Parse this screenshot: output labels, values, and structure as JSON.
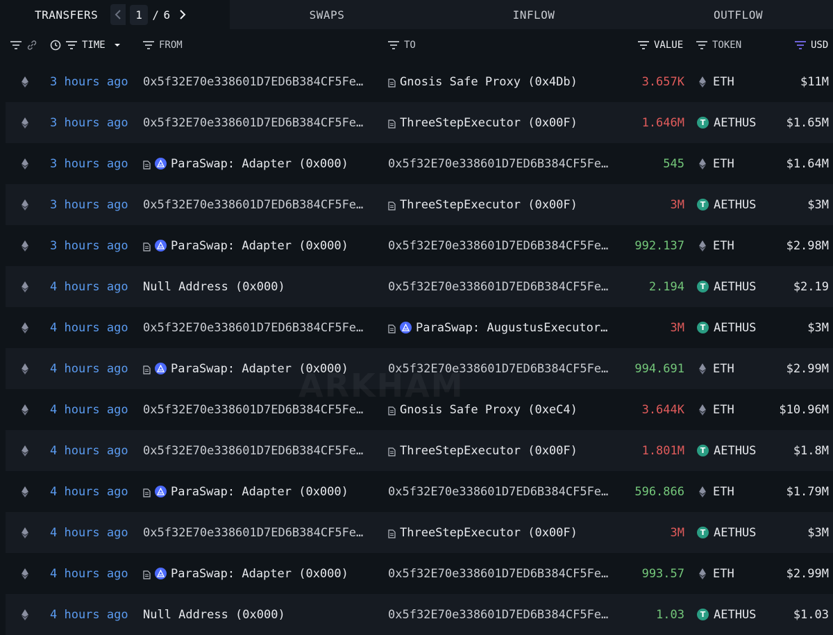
{
  "tabs": {
    "transfers": "TRANSFERS",
    "swaps": "SWAPS",
    "inflow": "INFLOW",
    "outflow": "OUTFLOW",
    "page_current": "1",
    "page_separator": "/",
    "page_total": "6"
  },
  "columns": {
    "time": "TIME",
    "from": "FROM",
    "to": "TO",
    "value": "VALUE",
    "token": "TOKEN",
    "usd": "USD"
  },
  "watermark": "ARKHAM",
  "colors": {
    "background": "#0f1419",
    "row_alt": "#161b22",
    "time_link": "#5b9bf0",
    "outflow_value": "#e05b5b",
    "inflow_value": "#74c77a",
    "paraswap_badge": "#4d6bff",
    "aethus_badge": "#2a9d83"
  },
  "rows": [
    {
      "time": "3 hours ago",
      "from": "0x5f32E70e338601D7ED6B384CF5Fe…",
      "from_icon": "",
      "to": "Gnosis Safe Proxy (0x4Db)",
      "to_icon": "doc",
      "value": "3.657K",
      "dir": "neg",
      "token": "ETH",
      "token_icon": "eth",
      "usd": "$11M"
    },
    {
      "time": "3 hours ago",
      "from": "0x5f32E70e338601D7ED6B384CF5Fe…",
      "from_icon": "",
      "to": "ThreeStepExecutor (0x00F)",
      "to_icon": "doc",
      "value": "1.646M",
      "dir": "neg",
      "token": "AETHUS",
      "token_icon": "usdt",
      "usd": "$1.65M"
    },
    {
      "time": "3 hours ago",
      "from": "ParaSwap: Adapter (0x000)",
      "from_icon": "doc-para",
      "to": "0x5f32E70e338601D7ED6B384CF5Fe…",
      "to_icon": "",
      "value": "545",
      "dir": "pos",
      "token": "ETH",
      "token_icon": "eth",
      "usd": "$1.64M"
    },
    {
      "time": "3 hours ago",
      "from": "0x5f32E70e338601D7ED6B384CF5Fe…",
      "from_icon": "",
      "to": "ThreeStepExecutor (0x00F)",
      "to_icon": "doc",
      "value": "3M",
      "dir": "neg",
      "token": "AETHUS",
      "token_icon": "usdt",
      "usd": "$3M"
    },
    {
      "time": "3 hours ago",
      "from": "ParaSwap: Adapter (0x000)",
      "from_icon": "doc-para",
      "to": "0x5f32E70e338601D7ED6B384CF5Fe…",
      "to_icon": "",
      "value": "992.137",
      "dir": "pos",
      "token": "ETH",
      "token_icon": "eth",
      "usd": "$2.98M"
    },
    {
      "time": "4 hours ago",
      "from": "Null Address (0x000)",
      "from_icon": "",
      "to": "0x5f32E70e338601D7ED6B384CF5Fe…",
      "to_icon": "",
      "value": "2.194",
      "dir": "pos",
      "token": "AETHUS",
      "token_icon": "usdt",
      "usd": "$2.19"
    },
    {
      "time": "4 hours ago",
      "from": "0x5f32E70e338601D7ED6B384CF5Fe…",
      "from_icon": "",
      "to": "ParaSwap: AugustusExecutor…",
      "to_icon": "doc-para",
      "value": "3M",
      "dir": "neg",
      "token": "AETHUS",
      "token_icon": "usdt",
      "usd": "$3M"
    },
    {
      "time": "4 hours ago",
      "from": "ParaSwap: Adapter (0x000)",
      "from_icon": "doc-para",
      "to": "0x5f32E70e338601D7ED6B384CF5Fe…",
      "to_icon": "",
      "value": "994.691",
      "dir": "pos",
      "token": "ETH",
      "token_icon": "eth",
      "usd": "$2.99M"
    },
    {
      "time": "4 hours ago",
      "from": "0x5f32E70e338601D7ED6B384CF5Fe…",
      "from_icon": "",
      "to": "Gnosis Safe Proxy (0xeC4)",
      "to_icon": "doc",
      "value": "3.644K",
      "dir": "neg",
      "token": "ETH",
      "token_icon": "eth",
      "usd": "$10.96M"
    },
    {
      "time": "4 hours ago",
      "from": "0x5f32E70e338601D7ED6B384CF5Fe…",
      "from_icon": "",
      "to": "ThreeStepExecutor (0x00F)",
      "to_icon": "doc",
      "value": "1.801M",
      "dir": "neg",
      "token": "AETHUS",
      "token_icon": "usdt",
      "usd": "$1.8M"
    },
    {
      "time": "4 hours ago",
      "from": "ParaSwap: Adapter (0x000)",
      "from_icon": "doc-para",
      "to": "0x5f32E70e338601D7ED6B384CF5Fe…",
      "to_icon": "",
      "value": "596.866",
      "dir": "pos",
      "token": "ETH",
      "token_icon": "eth",
      "usd": "$1.79M"
    },
    {
      "time": "4 hours ago",
      "from": "0x5f32E70e338601D7ED6B384CF5Fe…",
      "from_icon": "",
      "to": "ThreeStepExecutor (0x00F)",
      "to_icon": "doc",
      "value": "3M",
      "dir": "neg",
      "token": "AETHUS",
      "token_icon": "usdt",
      "usd": "$3M"
    },
    {
      "time": "4 hours ago",
      "from": "ParaSwap: Adapter (0x000)",
      "from_icon": "doc-para",
      "to": "0x5f32E70e338601D7ED6B384CF5Fe…",
      "to_icon": "",
      "value": "993.57",
      "dir": "pos",
      "token": "ETH",
      "token_icon": "eth",
      "usd": "$2.99M"
    },
    {
      "time": "4 hours ago",
      "from": "Null Address (0x000)",
      "from_icon": "",
      "to": "0x5f32E70e338601D7ED6B384CF5Fe…",
      "to_icon": "",
      "value": "1.03",
      "dir": "pos",
      "token": "AETHUS",
      "token_icon": "usdt",
      "usd": "$1.03"
    }
  ]
}
